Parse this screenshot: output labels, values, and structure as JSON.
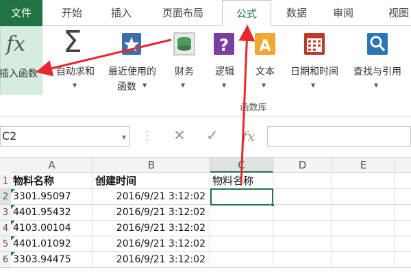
{
  "tabs": [
    {
      "label": "文件"
    },
    {
      "label": "开始"
    },
    {
      "label": "插入"
    },
    {
      "label": "页面布局"
    },
    {
      "label": "公式"
    },
    {
      "label": "数据"
    },
    {
      "label": "审阅"
    },
    {
      "label": "视图"
    }
  ],
  "ribbon": {
    "insert_function": {
      "glyph": "fx",
      "label": "插入函数"
    },
    "autosum": {
      "glyph": "Σ",
      "label": "自动求和"
    },
    "recent": {
      "line1": "最近使用的",
      "line2": "函数"
    },
    "financial": {
      "label": "财务"
    },
    "logical": {
      "label": "逻辑"
    },
    "text": {
      "label": "文本"
    },
    "datetime": {
      "label": "日期和时间"
    },
    "lookup": {
      "label": "查找与引用"
    },
    "group_name": "函数库"
  },
  "formula_bar": {
    "name_box": "C2",
    "cancel": "✕",
    "enter": "✓",
    "fx": "fx",
    "formula": ""
  },
  "columns": [
    "A",
    "B",
    "C",
    "D",
    "E"
  ],
  "rows": [
    {
      "num": "1",
      "a": "物料名称",
      "b": "创建时间",
      "c": "物料名称"
    },
    {
      "num": "2",
      "a": "3301.95097",
      "b": "2016/9/21  3:12:02",
      "c": ""
    },
    {
      "num": "3",
      "a": "4401.95432",
      "b": "2016/9/21  3:12:02",
      "c": ""
    },
    {
      "num": "4",
      "a": "4103.00104",
      "b": "2016/9/21  3:12:02",
      "c": ""
    },
    {
      "num": "5",
      "a": "4401.01092",
      "b": "2016/9/21  3:12:02",
      "c": ""
    },
    {
      "num": "6",
      "a": "3303.94475",
      "b": "2016/9/21  3:12:02",
      "c": ""
    }
  ],
  "colors": {
    "accent": "#217346",
    "arrow": "#e8262e"
  }
}
